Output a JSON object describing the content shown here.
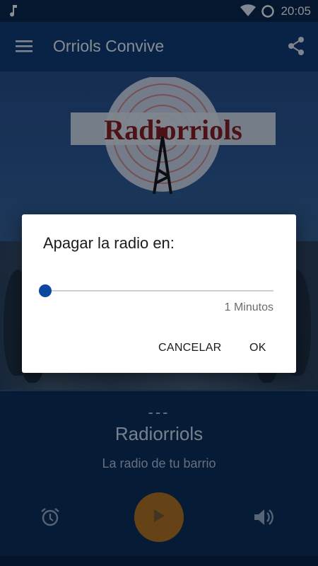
{
  "status_bar": {
    "time": "20:05",
    "icons": [
      "music-note-icon",
      "wifi-icon",
      "battery-icon"
    ]
  },
  "app_bar": {
    "title": "Orriols Convive",
    "icons": [
      "menu-icon",
      "share-icon"
    ]
  },
  "logo": {
    "text": "Radiorriols"
  },
  "now_playing": {
    "dashes": "---",
    "station": "Radiorriols",
    "slogan": "La radio de tu barrio"
  },
  "controls": {
    "icons": [
      "alarm-icon",
      "play-icon",
      "volume-icon"
    ]
  },
  "dialog": {
    "title": "Apagar la radio en:",
    "slider_value_fraction": 0,
    "slider_label": "1 Minutos",
    "cancel_label": "CANCELAR",
    "ok_label": "OK"
  },
  "colors": {
    "accent": "#0d47a1",
    "play_button": "#b8741a",
    "app_bar": "#103a6e"
  }
}
